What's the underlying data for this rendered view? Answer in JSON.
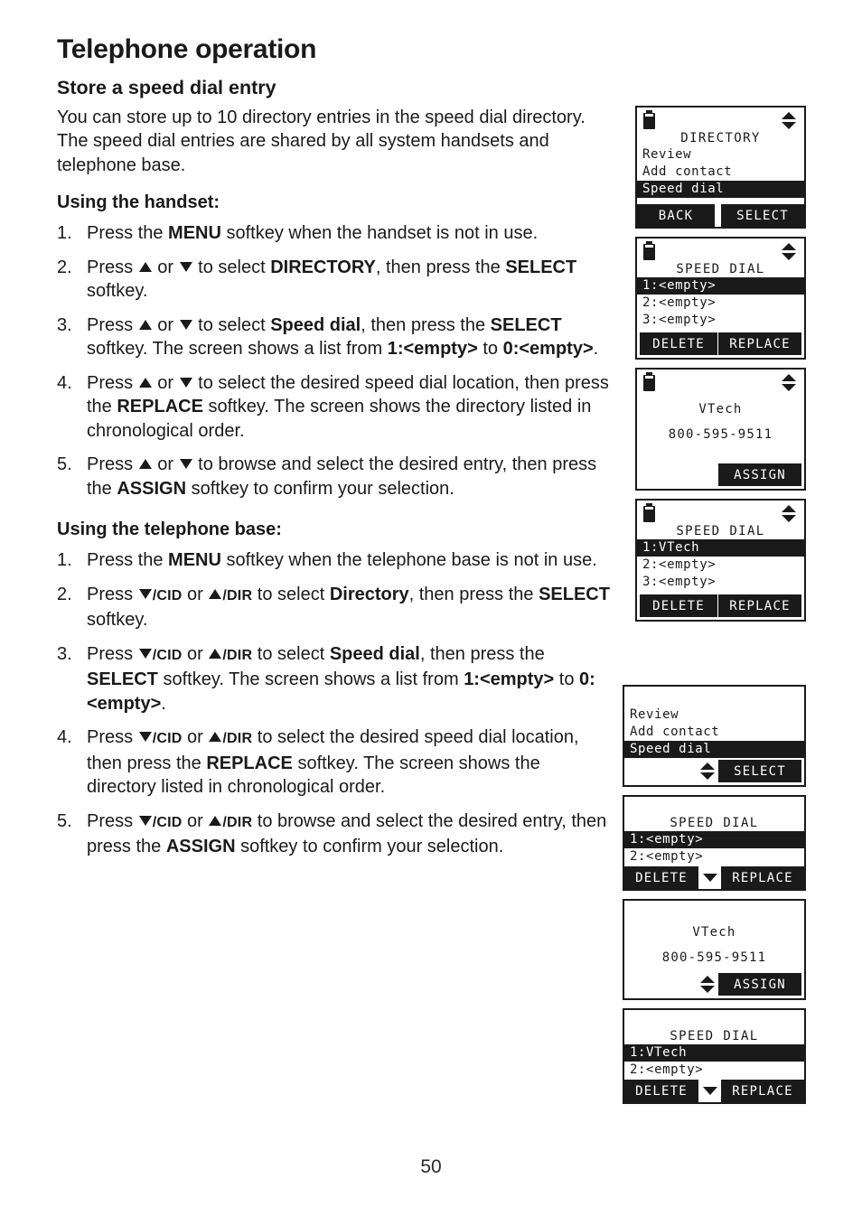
{
  "page": {
    "header": "Telephone operation",
    "section_title": "Store a speed dial entry",
    "intro": "You can store up to 10 directory entries in the speed dial directory. The speed dial entries are shared by all system handsets and telephone base.",
    "page_number": "50"
  },
  "handset": {
    "heading": "Using the handset:",
    "steps": [
      {
        "num": "1.",
        "html": "Press the <b>MENU</b> softkey when the handset is not in use."
      },
      {
        "num": "2.",
        "html": "Press <up> or <dn> to select <b>DIRECTORY</b>, then press the <b>SELECT</b> softkey."
      },
      {
        "num": "3.",
        "html": "Press <up> or <dn> to select <b>Speed dial</b>, then press the <b>SELECT</b> softkey. The screen shows a list from <b>1:&lt;empty&gt;</b> to <b>0:&lt;empty&gt;</b>."
      },
      {
        "num": "4.",
        "html": "Press <up> or <dn> to select the desired speed dial location, then press the <b>REPLACE</b> softkey. The screen shows the directory listed in chronological order."
      },
      {
        "num": "5.",
        "html": "Press <up> or <dn> to browse and select the desired entry, then press the <b>ASSIGN</b> softkey to confirm your selection."
      }
    ]
  },
  "base": {
    "heading": "Using the telephone base:",
    "steps": [
      {
        "num": "1.",
        "html": "Press the <b>MENU</b> softkey when the telephone base is not in use."
      },
      {
        "num": "2.",
        "html": "Press <dn><sc>/CID</sc> or <up><sc>/DIR</sc> to select <b>Directory</b>, then press the <b>SELECT</b> softkey."
      },
      {
        "num": "3.",
        "html": "Press <dn><sc>/CID</sc> or <up><sc>/DIR</sc> to select <b>Speed dial</b>, then press the <b>SELECT</b> softkey. The screen shows a list from <b>1:&lt;empty&gt;</b> to <b>0:&lt;empty&gt;</b>."
      },
      {
        "num": "4.",
        "html": "Press <dn><sc>/CID</sc> or <up><sc>/DIR</sc> to select the desired speed dial location, then press the <b>REPLACE</b> softkey. The screen shows the directory listed in chronological order."
      },
      {
        "num": "5.",
        "html": "Press <dn><sc>/CID</sc> or <up><sc>/DIR</sc> to browse and select the desired entry, then press the <b>ASSIGN</b> softkey to confirm your selection."
      }
    ]
  },
  "handset_screens": {
    "screen1": {
      "title": "DIRECTORY",
      "rows": [
        "Review",
        "Add contact"
      ],
      "selected_row": "Speed dial",
      "softkey_left": "BACK",
      "softkey_right": "SELECT"
    },
    "screen2": {
      "title": "SPEED DIAL",
      "selected_row": "1:<empty>",
      "rows": [
        "2:<empty>",
        "3:<empty>"
      ],
      "softkey_left": "DELETE",
      "softkey_right": "REPLACE"
    },
    "screen3": {
      "name": "VTech",
      "number": "800-595-9511",
      "softkey_right": "ASSIGN"
    },
    "screen4": {
      "title": "SPEED DIAL",
      "selected_row": "1:VTech",
      "rows": [
        "2:<empty>",
        "3:<empty>"
      ],
      "softkey_left": "DELETE",
      "softkey_right": "REPLACE"
    }
  },
  "base_screens": {
    "screen1": {
      "rows": [
        "Review",
        "Add contact"
      ],
      "selected_row": "Speed dial",
      "softkey_right": "SELECT"
    },
    "screen2": {
      "title": "SPEED DIAL",
      "selected_row": "1:<empty>",
      "rows": [
        "2:<empty>"
      ],
      "softkey_left": "DELETE",
      "softkey_right": "REPLACE"
    },
    "screen3": {
      "name": "VTech",
      "number": "800-595-9511",
      "softkey_right": "ASSIGN"
    },
    "screen4": {
      "title": "SPEED DIAL",
      "selected_row": "1:VTech",
      "rows": [
        "2:<empty>"
      ],
      "softkey_left": "DELETE",
      "softkey_right": "REPLACE"
    }
  }
}
